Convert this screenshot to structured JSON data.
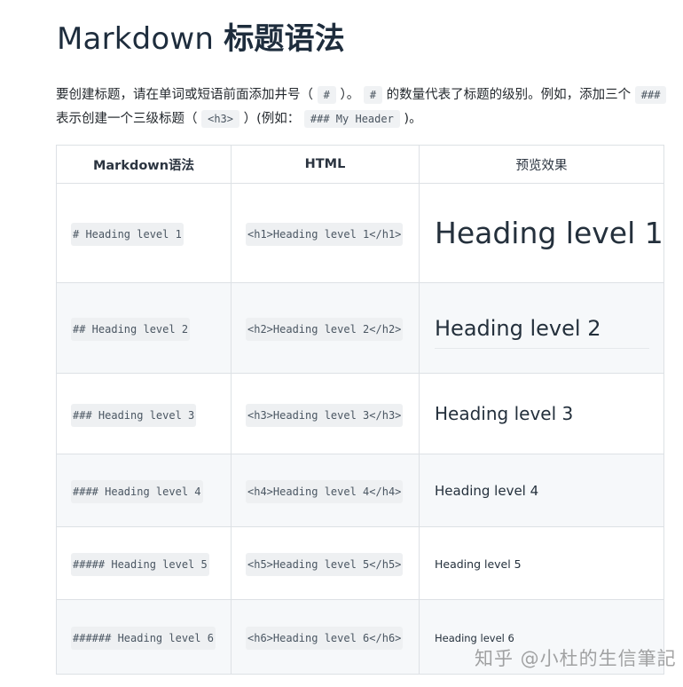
{
  "page": {
    "title_prefix": "Markdown ",
    "title_cn": "标题语法"
  },
  "intro": {
    "line1_a": "要创建标题，请在单词或短语前面添加井号（ ",
    "code_hash": "#",
    "line1_b": " ）。 ",
    "code_hash2": "#",
    "line1_c": " 的数量代表了标题的级别。例如，添加三个 ",
    "code_hash3": "###",
    "line2_a": "表示创建一个三级标题（ ",
    "code_h3": "<h3>",
    "line2_b": " ）(例如： ",
    "code_example": "### My Header",
    "line2_c": " )。"
  },
  "table": {
    "headers": [
      "Markdown语法",
      "HTML",
      "预览效果"
    ],
    "rows": [
      {
        "markdown": "# Heading level 1",
        "html": "<h1>Heading level 1</h1>",
        "preview": "Heading level 1"
      },
      {
        "markdown": "## Heading level 2",
        "html": "<h2>Heading level 2</h2>",
        "preview": "Heading level 2"
      },
      {
        "markdown": "### Heading level 3",
        "html": "<h3>Heading level 3</h3>",
        "preview": "Heading level 3"
      },
      {
        "markdown": "#### Heading level 4",
        "html": "<h4>Heading level 4</h4>",
        "preview": "Heading level 4"
      },
      {
        "markdown": "##### Heading level 5",
        "html": "<h5>Heading level 5</h5>",
        "preview": "Heading level 5"
      },
      {
        "markdown": "###### Heading level 6",
        "html": "<h6>Heading level 6</h6>",
        "preview": "Heading level 6"
      }
    ]
  },
  "watermark": "知乎 @小杜的生信筆記"
}
